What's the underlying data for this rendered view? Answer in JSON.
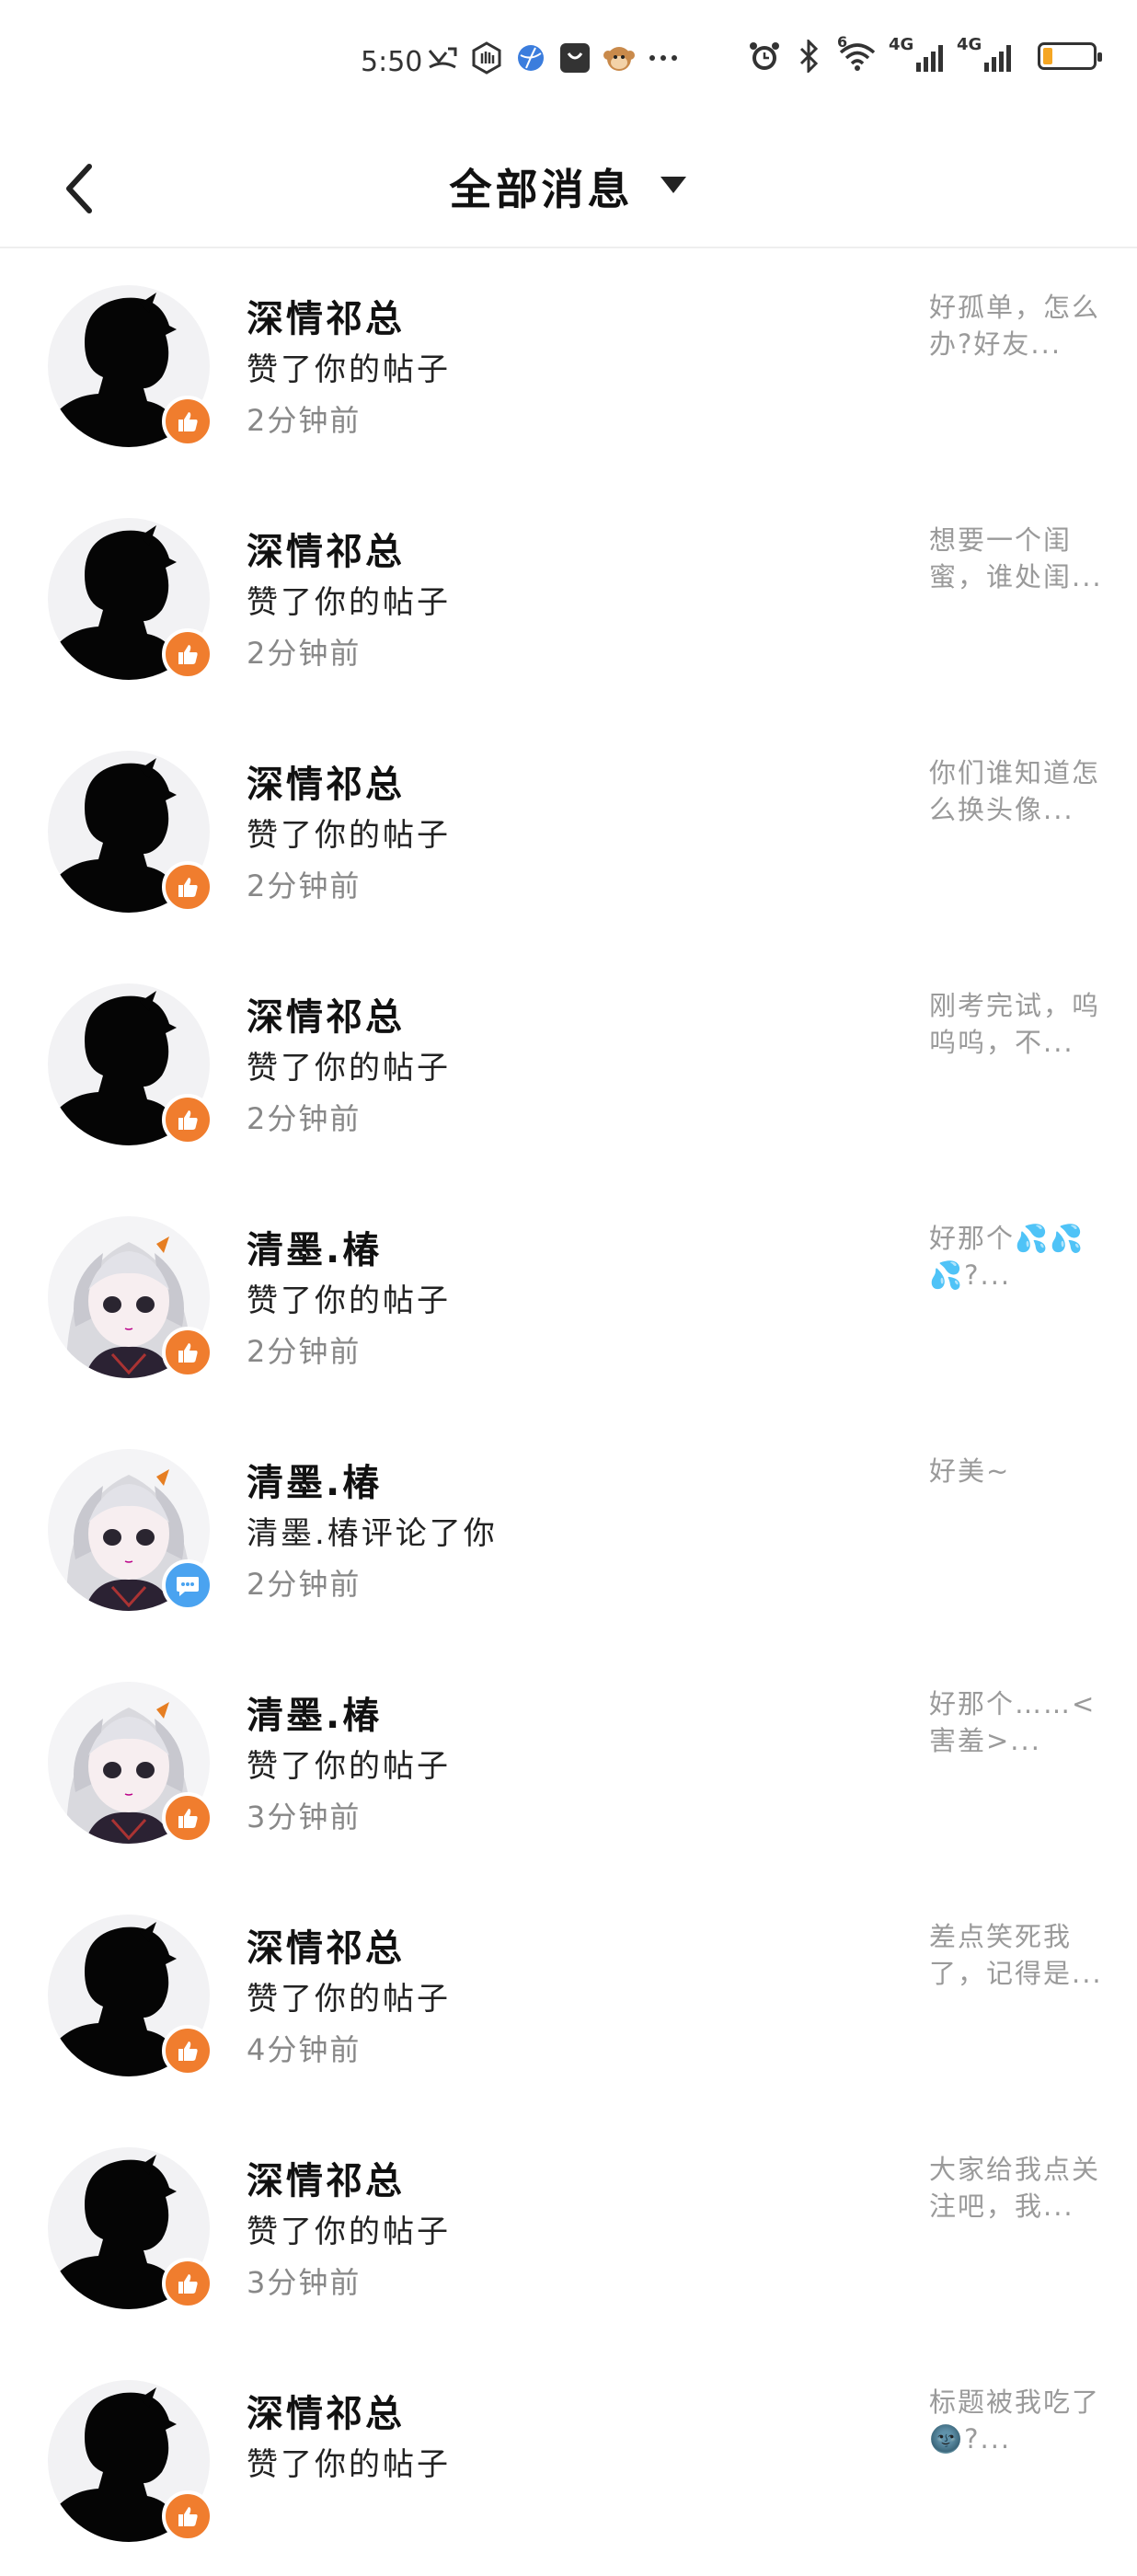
{
  "status_bar": {
    "time": "5:50",
    "network_1": "4G",
    "network_2": "4G",
    "wifi_badge": "6",
    "icons_left": [
      "missed-call-icon",
      "hand-icon",
      "globe-icon",
      "bag-icon",
      "monkey-icon",
      "more-dots-icon"
    ],
    "icons_right": [
      "alarm-icon",
      "bluetooth-icon",
      "wifi-icon",
      "signal-icon",
      "signal-icon",
      "battery-icon"
    ],
    "battery_level": 0.2,
    "battery_color": "#f5a623"
  },
  "header": {
    "title": "全部消息"
  },
  "colors": {
    "like_badge": "#f07d2e",
    "comment_badge": "#4aa3f0"
  },
  "messages": [
    {
      "name": "深情祁总",
      "action": "赞了你的帖子",
      "time": "2分钟前",
      "preview": "好孤单，怎么办?好友...",
      "avatar": "silhouette",
      "badge": "like"
    },
    {
      "name": "深情祁总",
      "action": "赞了你的帖子",
      "time": "2分钟前",
      "preview": "想要一个闺蜜，谁处闺...",
      "avatar": "silhouette",
      "badge": "like"
    },
    {
      "name": "深情祁总",
      "action": "赞了你的帖子",
      "time": "2分钟前",
      "preview": "你们谁知道怎么换头像...",
      "avatar": "silhouette",
      "badge": "like"
    },
    {
      "name": "深情祁总",
      "action": "赞了你的帖子",
      "time": "2分钟前",
      "preview": "刚考完试，呜呜呜，不...",
      "avatar": "silhouette",
      "badge": "like"
    },
    {
      "name": "清墨.椿",
      "action": "赞了你的帖子",
      "time": "2分钟前",
      "preview": "好那个💦💦💦?...",
      "avatar": "anime",
      "badge": "like"
    },
    {
      "name": "清墨.椿",
      "action": "清墨.椿评论了你",
      "time": "2分钟前",
      "preview": "好美~",
      "avatar": "anime",
      "badge": "comment"
    },
    {
      "name": "清墨.椿",
      "action": "赞了你的帖子",
      "time": "3分钟前",
      "preview": "好那个……<害羞>...",
      "avatar": "anime",
      "badge": "like"
    },
    {
      "name": "深情祁总",
      "action": "赞了你的帖子",
      "time": "4分钟前",
      "preview": "差点笑死我了，记得是...",
      "avatar": "silhouette",
      "badge": "like"
    },
    {
      "name": "深情祁总",
      "action": "赞了你的帖子",
      "time": "3分钟前",
      "preview": "大家给我点关注吧，我...",
      "avatar": "silhouette",
      "badge": "like"
    },
    {
      "name": "深情祁总",
      "action": "赞了你的帖子",
      "time": "",
      "preview": "标题被我吃了🌚?...",
      "avatar": "silhouette",
      "badge": "like"
    }
  ]
}
